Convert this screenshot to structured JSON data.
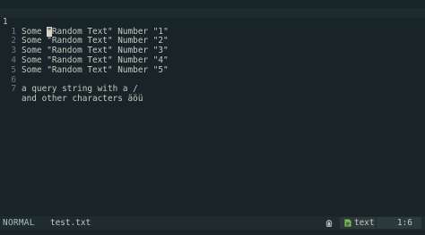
{
  "editor": {
    "lines": [
      {
        "number": "1",
        "before_cursor": "Some ",
        "cursor_char": "\"",
        "after_cursor": "Random Text\" Number \"1\""
      },
      {
        "number": "1",
        "text": "Some \"Random Text\" Number \"2\""
      },
      {
        "number": "2",
        "text": "Some \"Random Text\" Number \"3\""
      },
      {
        "number": "3",
        "text": "Some \"Random Text\" Number \"4\""
      },
      {
        "number": "4",
        "text": "Some \"Random Text\" Number \"5\""
      },
      {
        "number": "5",
        "text": ""
      },
      {
        "number": "6",
        "text": "a query string with a /"
      },
      {
        "number": "7",
        "text": "and other characters äöü"
      }
    ]
  },
  "statusbar": {
    "mode": "NORMAL",
    "filename": "test.txt",
    "os_icon": "linux-penguin-icon",
    "filetype_icon": "text-file-icon",
    "filetype": "text",
    "position": "1:6"
  },
  "colors": {
    "background": "#182427",
    "statusbar": "#1f2b2e",
    "current_line_number": "#c9c98f",
    "line_number": "#6d7a7a",
    "text": "#c6c9bf",
    "filetype_icon": "#7fbf5a"
  }
}
